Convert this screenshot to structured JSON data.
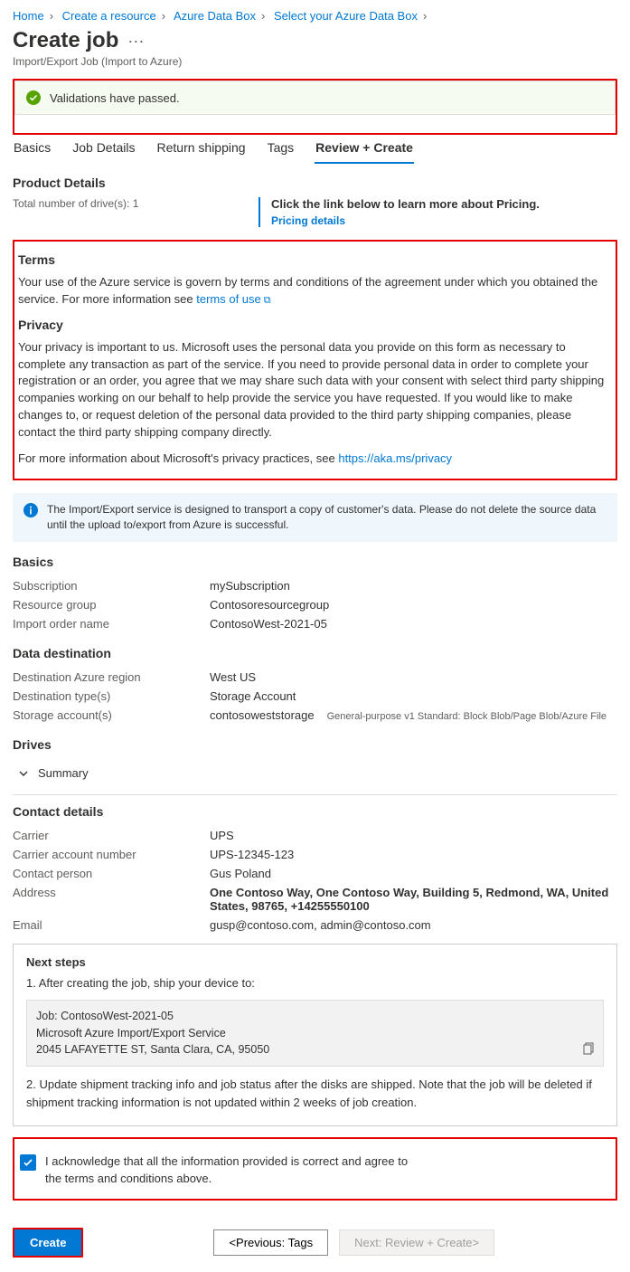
{
  "breadcrumb": [
    "Home",
    "Create a resource",
    "Azure Data Box",
    "Select your Azure Data Box"
  ],
  "title": "Create job",
  "subtitle": "Import/Export Job (Import to Azure)",
  "validation": "Validations have passed.",
  "tabs": [
    "Basics",
    "Job Details",
    "Return shipping",
    "Tags",
    "Review + Create"
  ],
  "activeTab": 4,
  "product": {
    "heading": "Product Details",
    "drivesLabel": "Total number of drive(s): 1",
    "pricingLead": "Click the link below to learn more about Pricing.",
    "pricingLink": "Pricing details"
  },
  "terms": {
    "heading": "Terms",
    "body": "Your use of the Azure service is govern by terms and conditions of the agreement under which you obtained the service. For more information see ",
    "link": "terms of use",
    "privacyHeading": "Privacy",
    "privacyBody": "Your privacy is important to us. Microsoft uses the personal data you provide on this form as necessary to complete any transaction as part of the service. If you need to provide personal data in order to complete your registration or an order, you agree that we may share such data with your consent with select third party shipping companies working on our behalf to help provide the service you have requested. If you would like to make changes to, or request deletion of the personal data provided to the third party shipping companies, please contact the third party shipping company directly.",
    "privacyMore": "For more information about Microsoft's privacy practices, see ",
    "privacyLink": "https://aka.ms/privacy"
  },
  "infoBox": "The Import/Export service is designed to transport a copy of customer's data. Please do not delete the source data until the upload to/export from Azure is successful.",
  "basics": {
    "heading": "Basics",
    "rows": [
      {
        "k": "Subscription",
        "v": "mySubscription"
      },
      {
        "k": "Resource group",
        "v": "Contosoresourcegroup"
      },
      {
        "k": "Import order name",
        "v": "ContosoWest-2021-05"
      }
    ]
  },
  "dest": {
    "heading": "Data destination",
    "rows": [
      {
        "k": "Destination Azure region",
        "v": "West US"
      },
      {
        "k": "Destination type(s)",
        "v": "Storage Account"
      },
      {
        "k": "Storage account(s)",
        "v": "contosoweststorage",
        "hint": "General-purpose v1 Standard: Block Blob/Page Blob/Azure File"
      }
    ]
  },
  "drives": {
    "heading": "Drives",
    "summary": "Summary"
  },
  "contact": {
    "heading": "Contact details",
    "rows": [
      {
        "k": "Carrier",
        "v": "UPS"
      },
      {
        "k": "Carrier account number",
        "v": "UPS-12345-123"
      },
      {
        "k": "Contact person",
        "v": "Gus Poland"
      },
      {
        "k": "Address",
        "v": "One Contoso Way, One Contoso Way, Building 5, Redmond, WA, United States, 98765, +14255550100"
      },
      {
        "k": "Email",
        "v": "gusp@contoso.com, admin@contoso.com"
      }
    ]
  },
  "next": {
    "heading": "Next steps",
    "step1": "1. After creating the job, ship your device to:",
    "code": "Job: ContosoWest-2021-05\nMicrosoft Azure Import/Export Service\n2045 LAFAYETTE ST, Santa Clara, CA, 95050",
    "step2": "2. Update shipment tracking info and job status after the disks are shipped. Note that the job will be deleted if shipment tracking information is not updated within 2 weeks of job creation."
  },
  "ack": "I acknowledge that all the information provided is correct and agree to the terms and conditions above.",
  "footer": {
    "create": "Create",
    "prev": "<Previous: Tags",
    "next": "Next: Review + Create>"
  }
}
